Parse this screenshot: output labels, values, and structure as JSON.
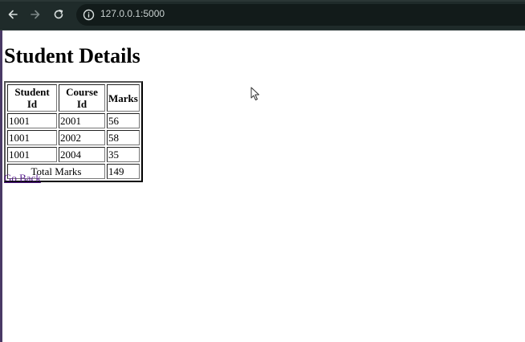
{
  "browser": {
    "url": "127.0.0.1:5000"
  },
  "page": {
    "title": "Student Details",
    "table": {
      "headers": [
        "Student Id",
        "Course Id",
        "Marks"
      ],
      "rows": [
        [
          "1001",
          "2001",
          "56"
        ],
        [
          "1001",
          "2002",
          "58"
        ],
        [
          "1001",
          "2004",
          "35"
        ]
      ],
      "total_label": "Total Marks",
      "total_value": "149"
    },
    "back_link": "Go Back"
  }
}
